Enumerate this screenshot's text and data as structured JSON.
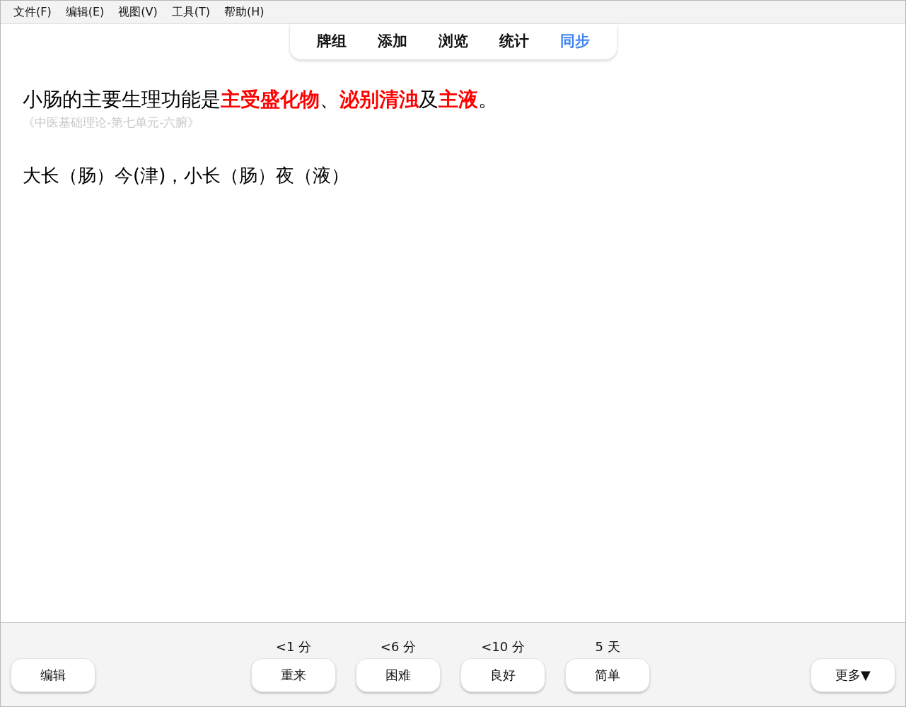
{
  "menu": [
    "文件(F)",
    "编辑(E)",
    "视图(V)",
    "工具(T)",
    "帮助(H)"
  ],
  "tabs": [
    {
      "label": "牌组",
      "selected": false
    },
    {
      "label": "添加",
      "selected": false
    },
    {
      "label": "浏览",
      "selected": false
    },
    {
      "label": "统计",
      "selected": false
    },
    {
      "label": "同步",
      "selected": true
    }
  ],
  "card": {
    "question": "小肠的主要生理功能是**主受盛化物**、**泌别清浊**及**主液**。",
    "source": "《中医基础理论-第七单元-六腑》",
    "answer": "大长（肠）今(津)，小长（肠）夜（液）"
  },
  "bottom": {
    "edit_button": "编辑",
    "answers": [
      {
        "interval": "<1 分",
        "label": "重来"
      },
      {
        "interval": "<6 分",
        "label": "困难"
      },
      {
        "interval": "<10 分",
        "label": "良好"
      },
      {
        "interval": "5 天",
        "label": "简单"
      }
    ],
    "more_button": "更多▼"
  }
}
